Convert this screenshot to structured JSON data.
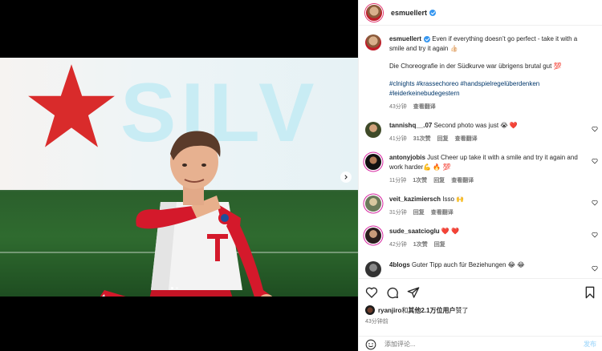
{
  "post": {
    "author": "esmuellert",
    "caption_line1": "Even if everything doesn’t go perfect - take it with a smile and try it again 👍🏻",
    "caption_line2": "Die Choreografie in der Südkurve war übrigens brutal gut 💯",
    "hashtags": "#clnights #krassechoreo #handspielregelüberdenken #leiderkeinebudegestern",
    "caption_time": "43分钟",
    "see_translation": "查看翻译",
    "likes_user": "ryanjiro",
    "likes_text_and": "和",
    "likes_text_others": "其他2.1万位用户",
    "likes_text_suffix": "赞了",
    "post_time": "43分钟前"
  },
  "comments": [
    {
      "user": "tannishq__.07",
      "text": "Second photo was just 😭 ❤️",
      "time": "41分钟",
      "likes": "31次赞",
      "reply": "回复",
      "translate": "查看翻译",
      "avatar_color": "#5a6a3a"
    },
    {
      "user": "antonyjobis",
      "text": "Just Cheer up take it with a smile and try it again and work harder💪 🔥 💯",
      "time": "11分钟",
      "likes": "1次赞",
      "reply": "回复",
      "translate": "查看翻译",
      "avatar_color": "#222222"
    },
    {
      "user": "veit_kazimiersch",
      "text": "Isso 🙌",
      "time": "31分钟",
      "likes": "",
      "reply": "回复",
      "translate": "查看翻译",
      "avatar_color": "#8a9a7a"
    },
    {
      "user": "sude_saatcioglu",
      "text": "❤️ ❤️",
      "time": "42分钟",
      "likes": "1次赞",
      "reply": "回复",
      "translate": "",
      "avatar_color": "#3a2a2a"
    },
    {
      "user": "4blogs",
      "text": "Guter Tipp auch für Beziehungen 😂 😂",
      "time": "",
      "likes": "",
      "reply": "",
      "translate": "",
      "avatar_color": "#444444"
    }
  ],
  "composer": {
    "placeholder": "添加评论...",
    "post_label": "发布"
  },
  "media": {
    "banner_text": "SILV",
    "carousel_total": 2,
    "carousel_index": 1
  },
  "colors": {
    "link": "#00376b",
    "meta": "#737373",
    "verified": "#3797f0",
    "jersey_red": "#d4192b"
  }
}
